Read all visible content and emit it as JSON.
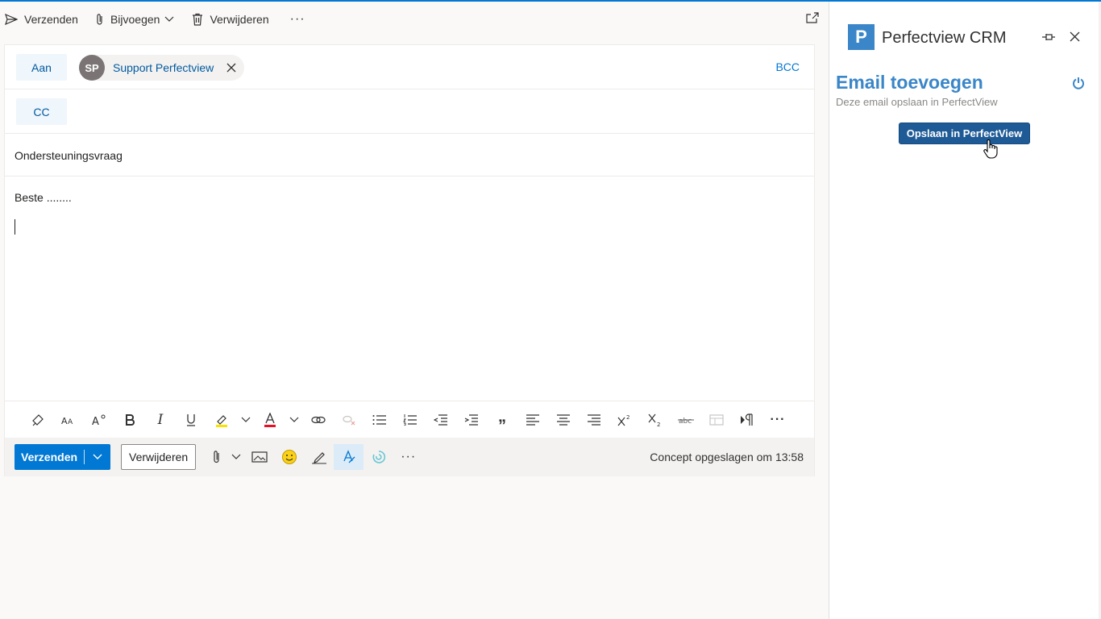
{
  "topbar": {
    "send_label": "Verzenden",
    "attach_label": "Bijvoegen",
    "delete_label": "Verwijderen",
    "more_label": "···"
  },
  "compose": {
    "to_label": "Aan",
    "cc_label": "CC",
    "bcc_label": "BCC",
    "recipient": {
      "initials": "SP",
      "name": "Support Perfectview"
    },
    "subject": "Ondersteuningsvraag",
    "body": "Beste ........"
  },
  "actions": {
    "send_label": "Verzenden",
    "delete_label": "Verwijderen",
    "more_label": "···",
    "status": "Concept opgeslagen om 13:58"
  },
  "format_toolbar": {
    "italic_glyph": "I",
    "quote_glyph": "„",
    "more_glyph": "···"
  },
  "addin": {
    "logo_letter": "P",
    "title": "Perfectview CRM",
    "heading": "Email toevoegen",
    "subheading": "Deze email opslaan in PerfectView",
    "save_button": "Opslaan in PerfectView"
  },
  "colors": {
    "accent": "#0078d4",
    "perfectview_blue": "#3a86c8",
    "save_button": "#1e5a96"
  }
}
